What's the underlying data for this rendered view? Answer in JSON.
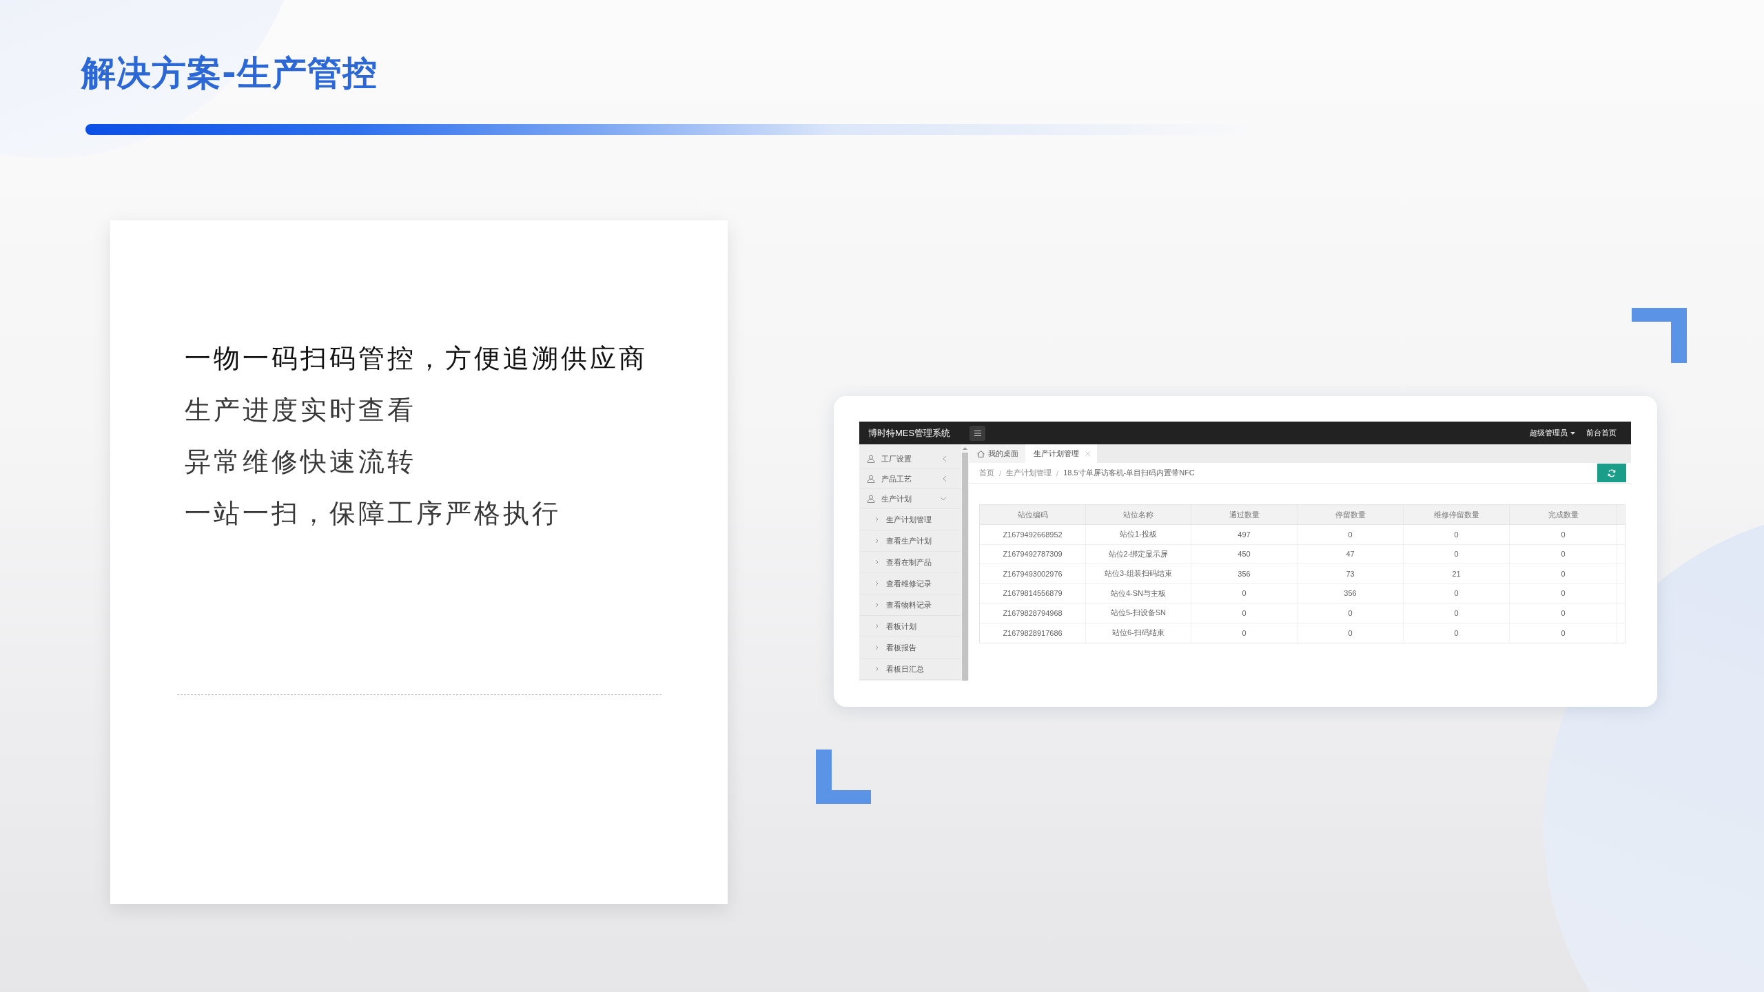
{
  "slide": {
    "title": "解决方案-生产管控"
  },
  "card": {
    "lines": [
      {
        "text": "一物一码扫码管控，方便追溯供应商",
        "highlighted": true
      },
      {
        "text": "生产进度实时查看",
        "highlighted": false
      },
      {
        "text": "异常维修快速流转",
        "highlighted": false
      },
      {
        "text": "一站一扫，保障工序严格执行",
        "highlighted": false
      }
    ]
  },
  "app": {
    "header": {
      "title": "博时特MES管理系统",
      "user_menu": "超级管理员",
      "home_link": "前台首页"
    },
    "sidebar": {
      "items": [
        {
          "label": "工厂设置",
          "expanded": false
        },
        {
          "label": "产品工艺",
          "expanded": false
        },
        {
          "label": "生产计划",
          "expanded": true,
          "children": [
            {
              "label": "生产计划管理"
            },
            {
              "label": "查看生产计划"
            },
            {
              "label": "查看在制产品"
            },
            {
              "label": "查看维修记录"
            },
            {
              "label": "查看物料记录"
            },
            {
              "label": "看板计划"
            },
            {
              "label": "看板报告"
            },
            {
              "label": "看板日汇总"
            }
          ]
        }
      ]
    },
    "tabs": [
      {
        "label": "我的桌面",
        "kind": "home",
        "selected": false
      },
      {
        "label": "生产计划管理",
        "kind": "page",
        "selected": true
      }
    ],
    "breadcrumb": [
      {
        "label": "首页",
        "separator": "/"
      },
      {
        "label": "生产计划管理",
        "separator": "/"
      },
      {
        "label": "18.5寸单屏访客机-单目扫码内置带NFC"
      }
    ],
    "table": {
      "columns": [
        "站位编码",
        "站位名称",
        "通过数量",
        "停留数量",
        "维修停留数量",
        "完成数量"
      ],
      "rows": [
        [
          "Z1679492668952",
          "站位1-投板",
          "497",
          "0",
          "0",
          "0"
        ],
        [
          "Z1679492787309",
          "站位2-绑定显示屏",
          "450",
          "47",
          "0",
          "0"
        ],
        [
          "Z1679493002976",
          "站位3-组装扫码结束",
          "356",
          "73",
          "21",
          "0"
        ],
        [
          "Z1679814556879",
          "站位4-SN与主板",
          "0",
          "356",
          "0",
          "0"
        ],
        [
          "Z1679828794968",
          "站位5-扫设备SN",
          "0",
          "0",
          "0",
          "0"
        ],
        [
          "Z1679828917686",
          "站位6-扫码结束",
          "0",
          "0",
          "0",
          "0"
        ]
      ]
    }
  }
}
